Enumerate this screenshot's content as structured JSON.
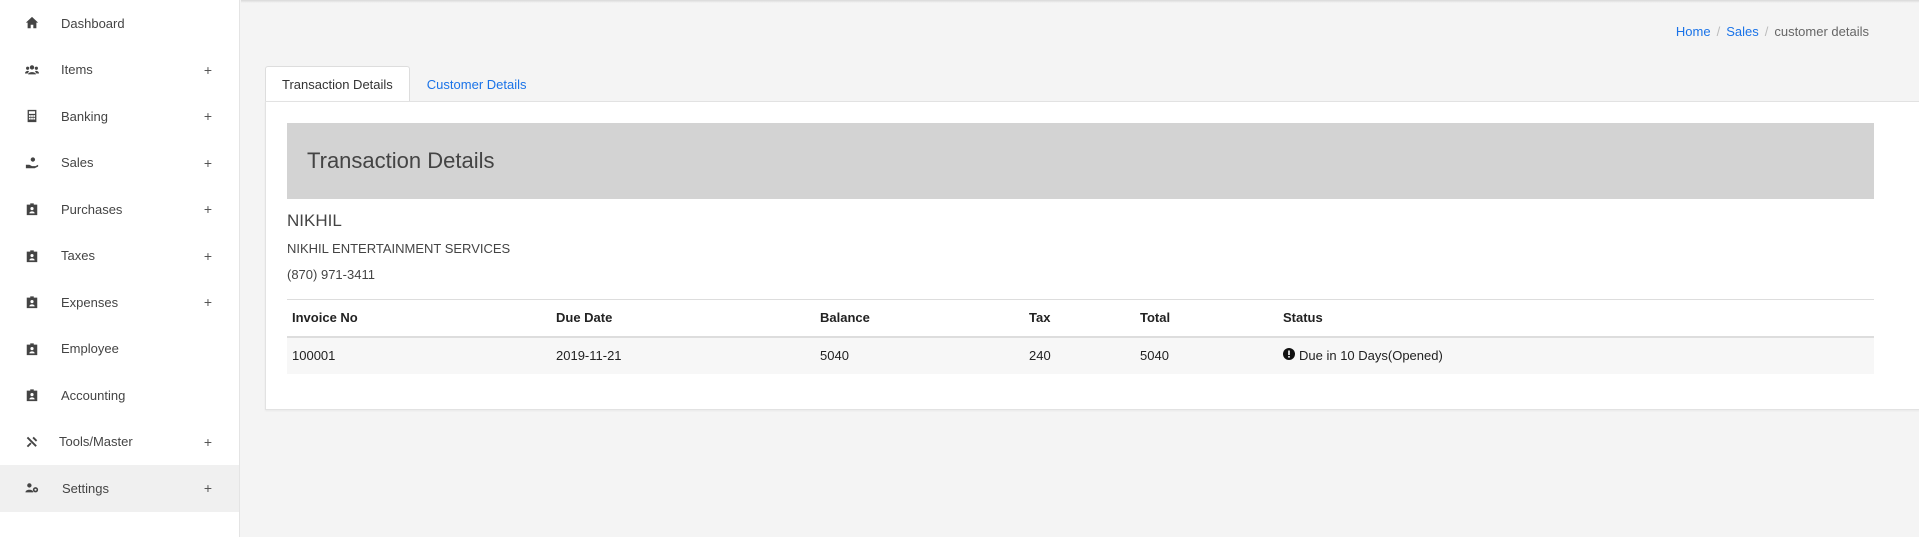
{
  "sidebar": {
    "items": [
      {
        "label": "Dashboard",
        "icon": "home-icon",
        "expandable": false
      },
      {
        "label": "Items",
        "icon": "users-icon",
        "expandable": true
      },
      {
        "label": "Banking",
        "icon": "calculator-icon",
        "expandable": true
      },
      {
        "label": "Sales",
        "icon": "hand-coin-icon",
        "expandable": true
      },
      {
        "label": "Purchases",
        "icon": "id-badge-icon",
        "expandable": true
      },
      {
        "label": "Taxes",
        "icon": "id-badge-icon",
        "expandable": true
      },
      {
        "label": "Expenses",
        "icon": "id-badge-icon",
        "expandable": true
      },
      {
        "label": "Employee",
        "icon": "id-badge-icon",
        "expandable": false
      },
      {
        "label": "Accounting",
        "icon": "id-badge-icon",
        "expandable": false
      },
      {
        "label": "Tools/Master",
        "icon": "tools-icon",
        "expandable": true
      },
      {
        "label": "Settings",
        "icon": "users-cog-icon",
        "expandable": true
      }
    ],
    "plus_symbol": "+"
  },
  "breadcrumb": {
    "home": "Home",
    "sales": "Sales",
    "current": "customer details",
    "separator": "/"
  },
  "tabs": {
    "transaction": "Transaction Details",
    "customer": "Customer Details"
  },
  "panel": {
    "title": "Transaction Details",
    "customer_name": "NIKHIL",
    "company": "NIKHIL ENTERTAINMENT SERVICES",
    "phone": "(870) 971-3411"
  },
  "table": {
    "headers": {
      "invoice": "Invoice No",
      "due": "Due Date",
      "balance": "Balance",
      "tax": "Tax",
      "total": "Total",
      "status": "Status"
    },
    "rows": [
      {
        "invoice": "100001",
        "due": "2019-11-21",
        "balance": "5040",
        "tax": "240",
        "total": "5040",
        "status": "Due in 10 Days(Opened)"
      }
    ]
  },
  "colors": {
    "link": "#1a73e8",
    "header_band": "#d3d3d3",
    "background": "#f4f4f4"
  }
}
